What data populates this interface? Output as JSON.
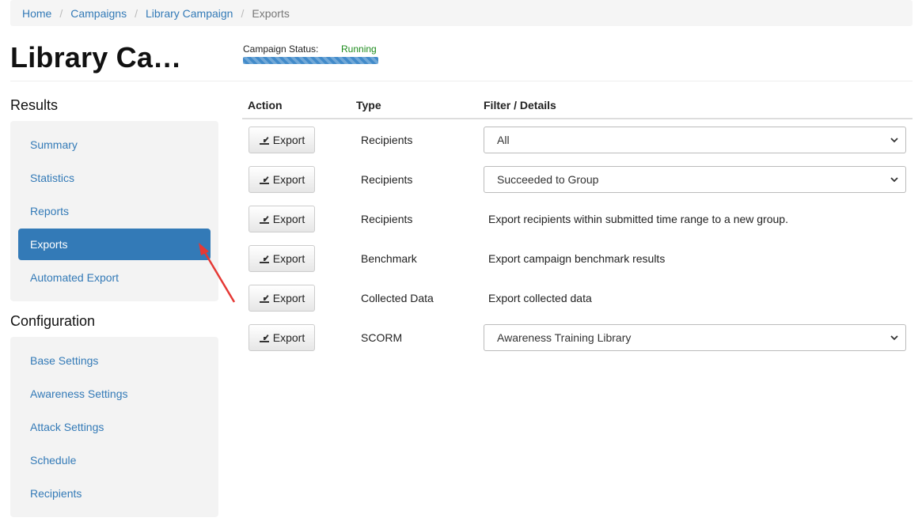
{
  "breadcrumb": {
    "items": [
      "Home",
      "Campaigns",
      "Library Campaign"
    ],
    "active": "Exports",
    "separator": "/"
  },
  "page": {
    "title": "Library Ca…",
    "status_label": "Campaign Status:",
    "status_value": "Running"
  },
  "sidebar": {
    "results_heading": "Results",
    "results_items": [
      "Summary",
      "Statistics",
      "Reports",
      "Exports",
      "Automated Export"
    ],
    "active_item": "Exports",
    "config_heading": "Configuration",
    "config_items": [
      "Base Settings",
      "Awareness Settings",
      "Attack Settings",
      "Schedule",
      "Recipients"
    ]
  },
  "table": {
    "headers": {
      "action": "Action",
      "type": "Type",
      "filter": "Filter / Details"
    },
    "rows": [
      {
        "button": "Export",
        "type": "Recipients",
        "select": "All"
      },
      {
        "button": "Export",
        "type": "Recipients",
        "select": "Succeeded to Group"
      },
      {
        "button": "Export",
        "type": "Recipients",
        "detail": "Export recipients within submitted time range to a new group."
      },
      {
        "button": "Export",
        "type": "Benchmark",
        "detail": "Export campaign benchmark results"
      },
      {
        "button": "Export",
        "type": "Collected Data",
        "detail": "Export collected data"
      },
      {
        "button": "Export",
        "type": "SCORM",
        "select": "Awareness Training Library"
      }
    ]
  },
  "icons": {
    "export": "export-icon",
    "dropdown": "chevron-down-icon"
  },
  "colors": {
    "link": "#337ab7",
    "running": "#1a8a1a",
    "annotation_arrow": "#e53935"
  }
}
